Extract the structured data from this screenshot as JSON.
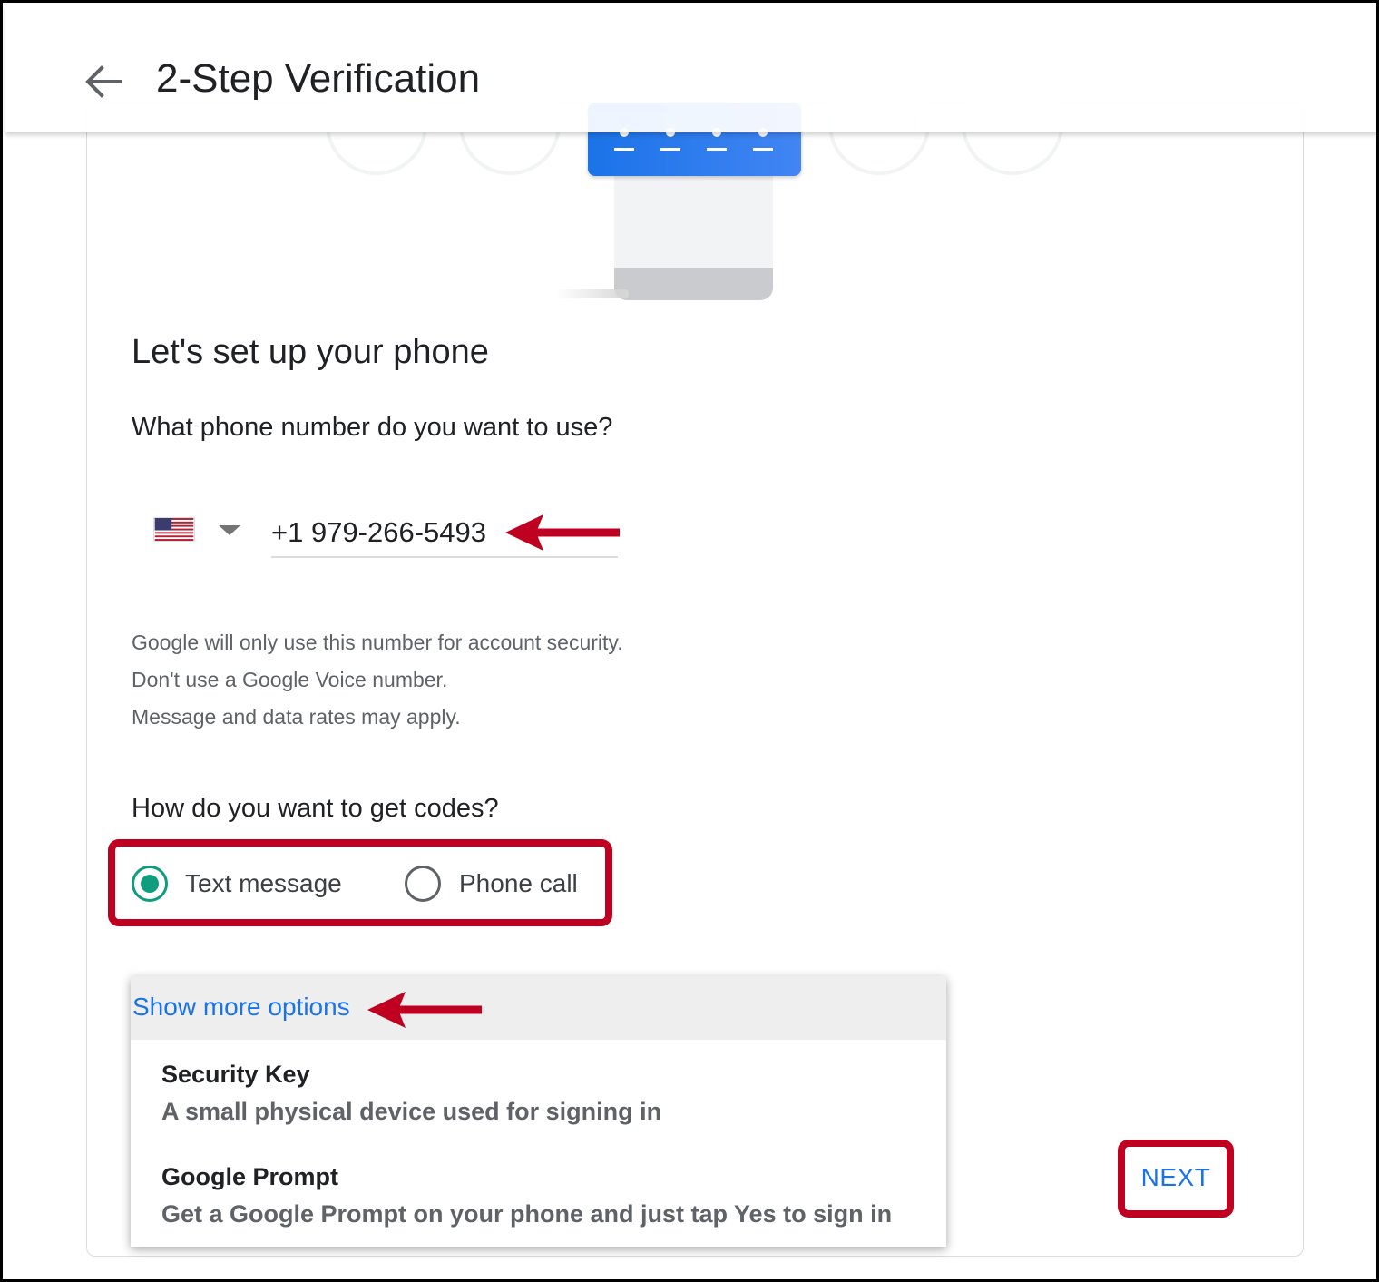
{
  "header": {
    "title": "2-Step Verification"
  },
  "setup": {
    "heading": "Let's set up your phone",
    "question": "What phone number do you want to use?",
    "country_flag": "us-flag-icon",
    "phone_number": "+1 979-266-5493",
    "info_lines": [
      "Google will only use this number for account security.",
      "Don't use a Google Voice number.",
      "Message and data rates may apply."
    ]
  },
  "codes": {
    "question": "How do you want to get codes?",
    "options": [
      {
        "label": "Text message",
        "selected": true
      },
      {
        "label": "Phone call",
        "selected": false
      }
    ]
  },
  "more_options": {
    "link": "Show more options",
    "items": [
      {
        "title": "Security Key",
        "description": "A small physical device used for signing in"
      },
      {
        "title": "Google Prompt",
        "description": "Get a Google Prompt on your phone and just tap Yes to sign in"
      }
    ]
  },
  "actions": {
    "next_label": "NEXT"
  },
  "colors": {
    "accent": "#1a73e8",
    "radio_selected": "#0f9d80",
    "annotation": "#c00020"
  }
}
